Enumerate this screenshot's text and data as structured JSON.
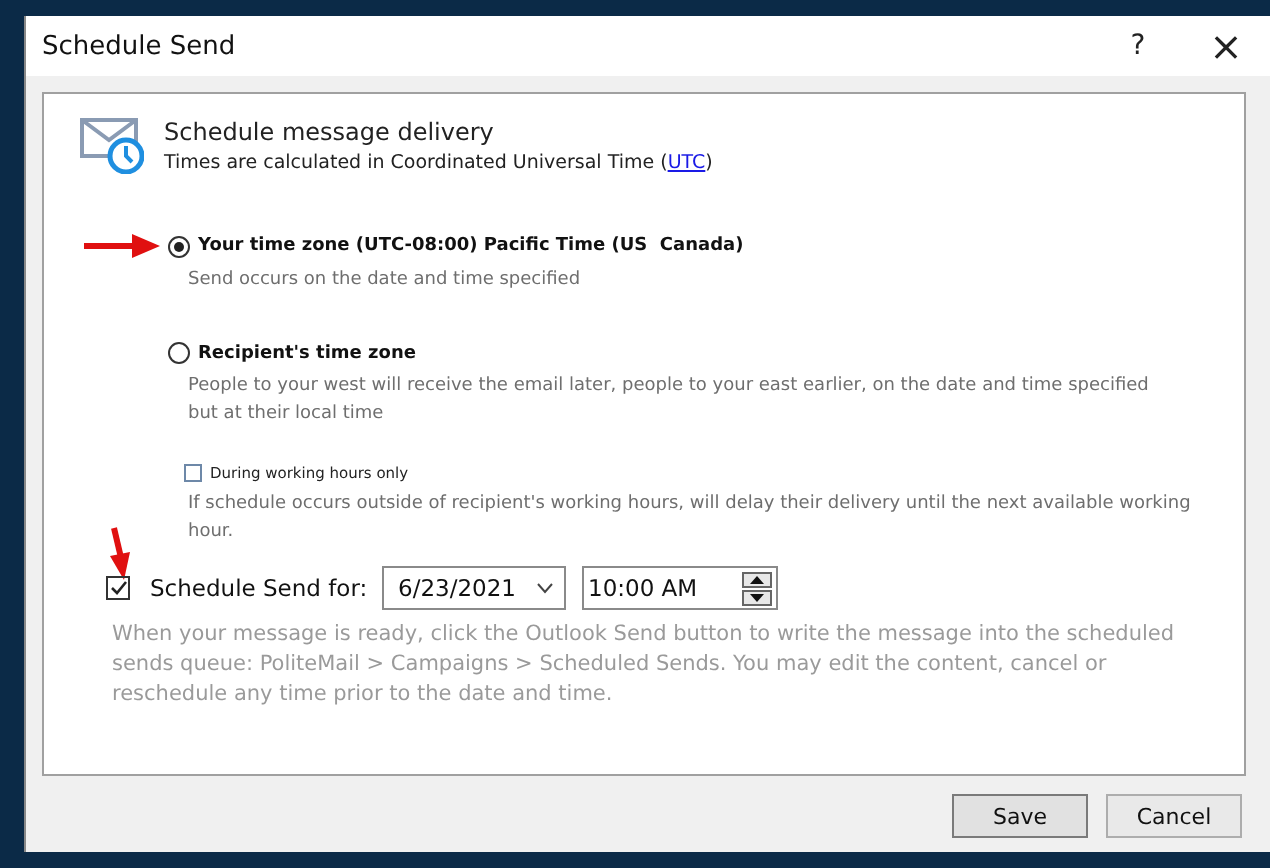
{
  "window": {
    "title": "Schedule Send",
    "help": "?",
    "close": "×"
  },
  "header": {
    "title": "Schedule message delivery",
    "subtitle_prefix": "Times are calculated in Coordinated Universal Time (",
    "link": "UTC",
    "subtitle_suffix": ")"
  },
  "time_zone_options": [
    {
      "label": "Your time zone (UTC-08:00) Pacific Time (US  Canada)",
      "description": "Send occurs on the date and time specified",
      "selected": true,
      "marked": true
    },
    {
      "label": "Recipient's time zone",
      "description": "People to your west will receive the email later, people to your east earlier, on the date and time specified but at their local time",
      "selected": false,
      "marked": false
    }
  ],
  "working_hours": {
    "label": "During working hours only",
    "checked": false,
    "description": "If schedule occurs outside of recipient's working hours, will delay their delivery until the next available working hour."
  },
  "schedule_send": {
    "label": "Schedule Send for:",
    "checked": true,
    "marked": true,
    "date": "6/23/2021",
    "time": "10:00 AM",
    "description": "When your message is ready, click the Outlook Send button to write the message into the scheduled sends queue: PoliteMail > Campaigns > Scheduled Sends. You may edit the content, cancel or reschedule any time prior to the date and time."
  },
  "buttons": [
    {
      "label": "Save",
      "kind": "default"
    },
    {
      "label": "Cancel",
      "kind": "normal"
    }
  ]
}
